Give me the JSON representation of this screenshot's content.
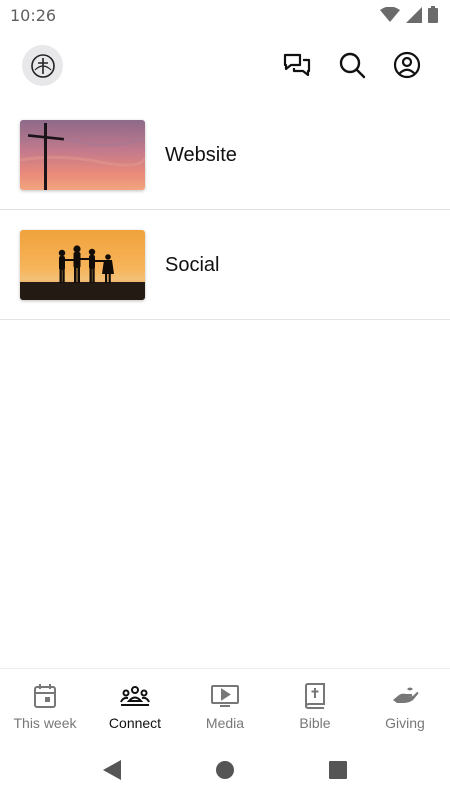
{
  "status_bar": {
    "time": "10:26",
    "icons": [
      "wifi-icon",
      "signal-icon",
      "battery-icon"
    ]
  },
  "header": {
    "logo": "church-logo",
    "actions": [
      "chat-icon",
      "search-icon",
      "profile-icon"
    ]
  },
  "list": {
    "items": [
      {
        "label": "Website",
        "thumbnail": "cross-sunset"
      },
      {
        "label": "Social",
        "thumbnail": "family-silhouette-sunset"
      }
    ]
  },
  "bottom_nav": {
    "active_tab": "Connect",
    "tabs": [
      {
        "label": "This week",
        "icon": "calendar-icon"
      },
      {
        "label": "Connect",
        "icon": "people-icon"
      },
      {
        "label": "Media",
        "icon": "media-icon"
      },
      {
        "label": "Bible",
        "icon": "bible-icon"
      },
      {
        "label": "Giving",
        "icon": "giving-hand-icon"
      }
    ]
  },
  "colors": {
    "active": "#111111",
    "inactive": "#777777",
    "divider": "#e3e3e3"
  }
}
